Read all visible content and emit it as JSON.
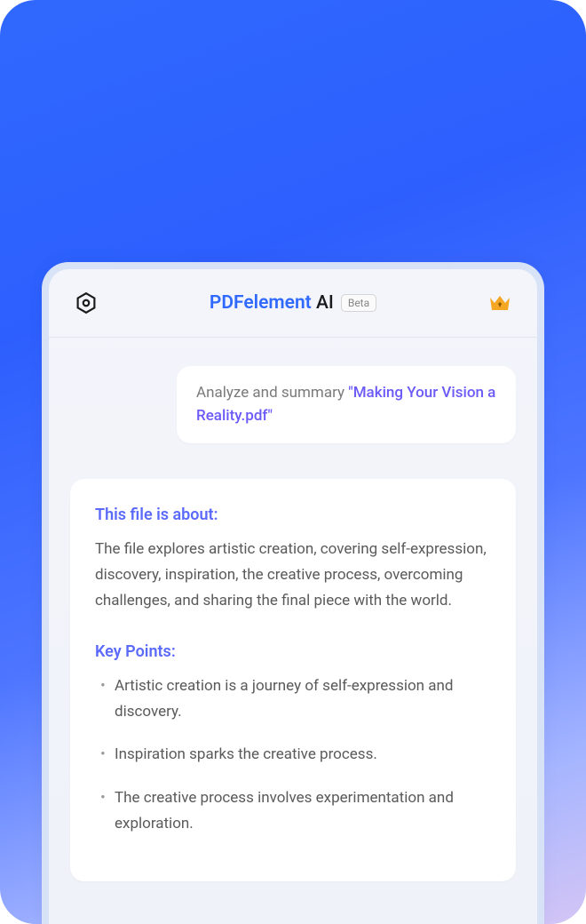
{
  "header": {
    "title_main": "PDFelement",
    "title_ai": "AI",
    "beta_label": "Beta"
  },
  "user_message": {
    "prefix": "Analyze and summary  ",
    "filename": "\"Making Your Vision a Reality.pdf\""
  },
  "ai_response": {
    "about_heading": "This file is about:",
    "about_text": "The file explores artistic creation, covering self-expression, discovery, inspiration, the creative process, overcoming challenges, and sharing the final piece with the world.",
    "keypoints_heading": "Key Points:",
    "keypoints": [
      "Artistic creation is a journey of self-expression and discovery.",
      "Inspiration sparks the creative process.",
      "The creative process involves experimentation and exploration."
    ]
  }
}
